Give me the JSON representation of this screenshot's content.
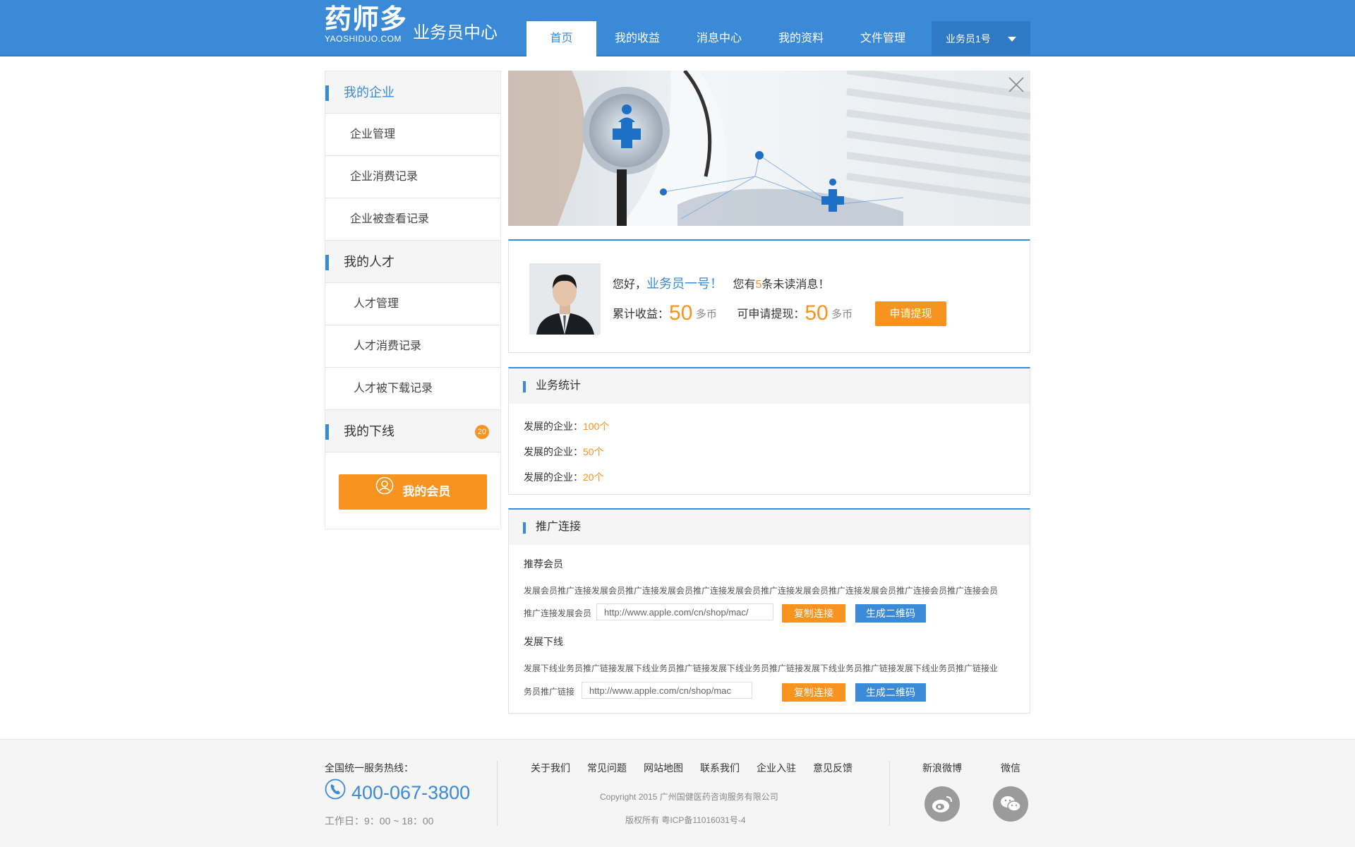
{
  "header": {
    "logo_main": "药师多",
    "logo_sub": "YAOSHIDUO.COM",
    "site_title": "业务员中心",
    "nav": [
      "首页",
      "我的收益",
      "消息中心",
      "我的资料",
      "文件管理"
    ],
    "user": "业务员1号"
  },
  "sidebar": {
    "group_company": "我的企业",
    "company_items": [
      "企业管理",
      "企业消费记录",
      "企业被查看记录"
    ],
    "group_talent": "我的人才",
    "talent_items": [
      "人才管理",
      "人才消费记录",
      "人才被下载记录"
    ],
    "group_down": "我的下线",
    "down_badge": "20",
    "member_button": "我的会员"
  },
  "profile": {
    "greeting_prefix": "您好，",
    "name": "业务员一号！",
    "unread_prefix": "您有",
    "unread_count": "5",
    "unread_suffix": "条未读消息！",
    "total_label": "累计收益：",
    "total_value": "50",
    "total_unit": "多币",
    "withdrawable_label": "可申请提现：",
    "withdrawable_value": "50",
    "withdrawable_unit": "多币",
    "withdraw_button": "申请提现"
  },
  "stats": {
    "title": "业务统计",
    "rows": [
      {
        "label": "发展的企业：",
        "value": "100个"
      },
      {
        "label": "发展的企业：",
        "value": "50个"
      },
      {
        "label": "发展的企业：",
        "value": "20个"
      }
    ]
  },
  "promo": {
    "title": "推广连接",
    "member_title": "推荐会员",
    "member_desc_line1": "发展会员推广连接发展会员推广连接发展会员推广连接发展会员推广连接发展会员推广连接发展会员推广连接会员推广连接会员",
    "member_desc_line2": "推广连接发展会员",
    "member_url": "http://www.apple.com/cn/shop/mac/",
    "downline_title": "发展下线",
    "downline_desc_line1": "发展下线业务员推广链接发展下线业务员推广链接发展下线业务员推广链接发展下线业务员推广链接发展下线业务员推广链接业",
    "downline_desc_line2": "务员推广链接",
    "downline_url": "http://www.apple.com/cn/shop/mac",
    "copy_button": "复制连接",
    "qr_button": "生成二维码"
  },
  "footer": {
    "hotline_label": "全国统一服务热线：",
    "phone": "400-067-3800",
    "hours": "工作日：9：00 ~ 18：00",
    "links": [
      "关于我们",
      "常见问题",
      "网站地图",
      "联系我们",
      "企业入驻",
      "意见反馈"
    ],
    "copyright": "Copyright 2015 广州国健医药咨询服务有限公司",
    "icp": "版权所有    粤ICP备11016031号-4",
    "weibo": "新浪微博",
    "wechat": "微信"
  },
  "colors": {
    "primary": "#3b8ad8",
    "accent": "#f7931e",
    "footer_bg": "#f5f5f5"
  }
}
